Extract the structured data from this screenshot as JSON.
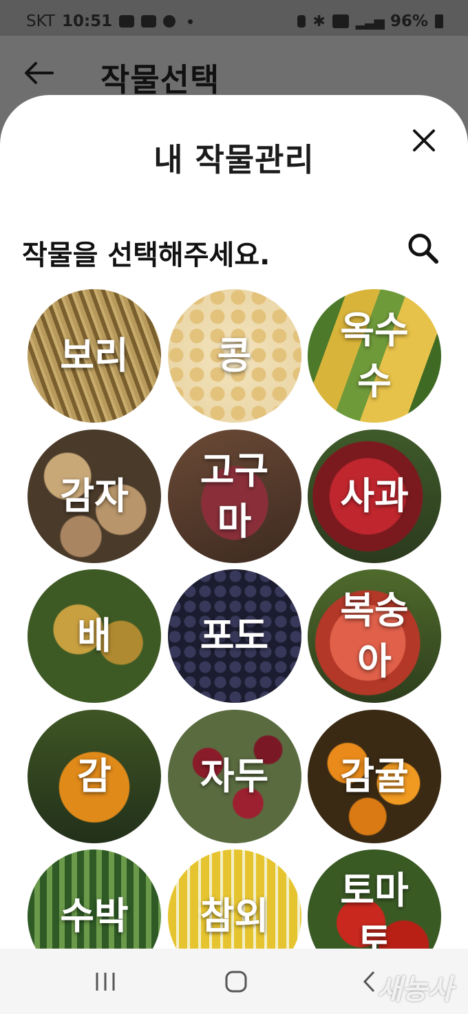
{
  "status_bar": {
    "carrier": "SKT",
    "time": "10:51",
    "battery": "96%"
  },
  "background": {
    "title": "작물선택"
  },
  "sheet": {
    "title": "내 작물관리",
    "prompt": "작물을 선택해주세요.",
    "crops": [
      {
        "label": "보리",
        "texture": "barley"
      },
      {
        "label": "콩",
        "texture": "soy"
      },
      {
        "label": "옥수수",
        "texture": "corn"
      },
      {
        "label": "감자",
        "texture": "potato"
      },
      {
        "label": "고구마",
        "texture": "sweet"
      },
      {
        "label": "사과",
        "texture": "apple"
      },
      {
        "label": "배",
        "texture": "pear"
      },
      {
        "label": "포도",
        "texture": "grape"
      },
      {
        "label": "복숭아",
        "texture": "peach"
      },
      {
        "label": "감",
        "texture": "persimmon"
      },
      {
        "label": "자두",
        "texture": "plum"
      },
      {
        "label": "감귤",
        "texture": "tangerine"
      },
      {
        "label": "수박",
        "texture": "watermelon"
      },
      {
        "label": "참외",
        "texture": "melon"
      },
      {
        "label": "토마토",
        "texture": "tomato"
      }
    ]
  },
  "watermark": "새농사"
}
